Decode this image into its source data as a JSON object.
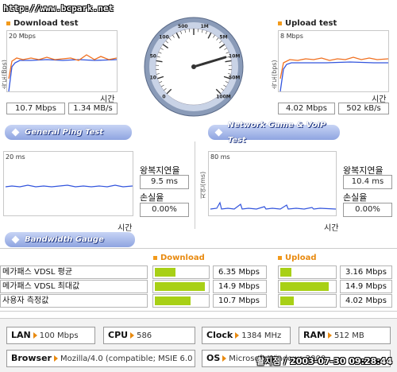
{
  "url_text": "http://www.bcpark.net",
  "download": {
    "title": "Download test",
    "scale": "20 Mbps",
    "ylabel": "속도(Bps)",
    "xlabel": "시간",
    "mbps": "10.7 Mbps",
    "mbs": "1.34 MB/s"
  },
  "upload": {
    "title": "Upload test",
    "scale": "8 Mbps",
    "ylabel": "속도(bps)",
    "xlabel": "시간",
    "mbps": "4.02 Mbps",
    "kbs": "502 kB/s"
  },
  "gauge": {
    "labels": [
      "0",
      "10",
      "50",
      "100",
      "500",
      "1M",
      "5M",
      "10M",
      "50M",
      "100M"
    ]
  },
  "ping": {
    "tab": "General Ping Test",
    "scale": "20 ms",
    "xlabel": "시간",
    "latency_label": "왕복지연율",
    "latency_value": "9.5 ms",
    "loss_label": "손실율",
    "loss_value": "0.00%"
  },
  "game": {
    "tab": "Network Game & VoIP Test",
    "scale": "80 ms",
    "ylabel": "지연(ms)",
    "xlabel": "시간",
    "latency_label": "왕복지연율",
    "latency_value": "10.4 ms",
    "loss_label": "손실율",
    "loss_value": "0.00%"
  },
  "bandwidth": {
    "tab": "Bandwidth Gauge",
    "download_head": "Download",
    "upload_head": "Upload",
    "rows": [
      {
        "label": "메가패스 VDSL 평균",
        "dl": "6.35 Mbps",
        "dl_fill": 0.4,
        "ul": "3.16 Mbps",
        "ul_fill": 0.2
      },
      {
        "label": "메가패스 VDSL 최대값",
        "dl": "14.9 Mbps",
        "dl_fill": 0.95,
        "ul": "14.9 Mbps",
        "ul_fill": 0.9
      },
      {
        "label": "사용자 측정값",
        "dl": "10.7 Mbps",
        "dl_fill": 0.68,
        "ul": "4.02 Mbps",
        "ul_fill": 0.25
      }
    ]
  },
  "sysinfo": {
    "lan_label": "LAN",
    "lan_value": "100 Mbps",
    "cpu_label": "CPU",
    "cpu_value": "586",
    "clock_label": "Clock",
    "clock_value": "1384 MHz",
    "ram_label": "RAM",
    "ram_value": "512 MB",
    "browser_label": "Browser",
    "browser_value": "Mozilla/4.0 (compatible; MSIE 6.0",
    "os_label": "OS",
    "os_value": "Microsoft Windows 2000"
  },
  "watermark": "촬지점 / 2003-07-30 09:28:44",
  "colors": {
    "accent_orange": "#f29a1c",
    "bar_green": "#a8d016",
    "tab_blue": "#8ea4e0",
    "line_blue": "#3355dd",
    "line_orange": "#f07020"
  }
}
